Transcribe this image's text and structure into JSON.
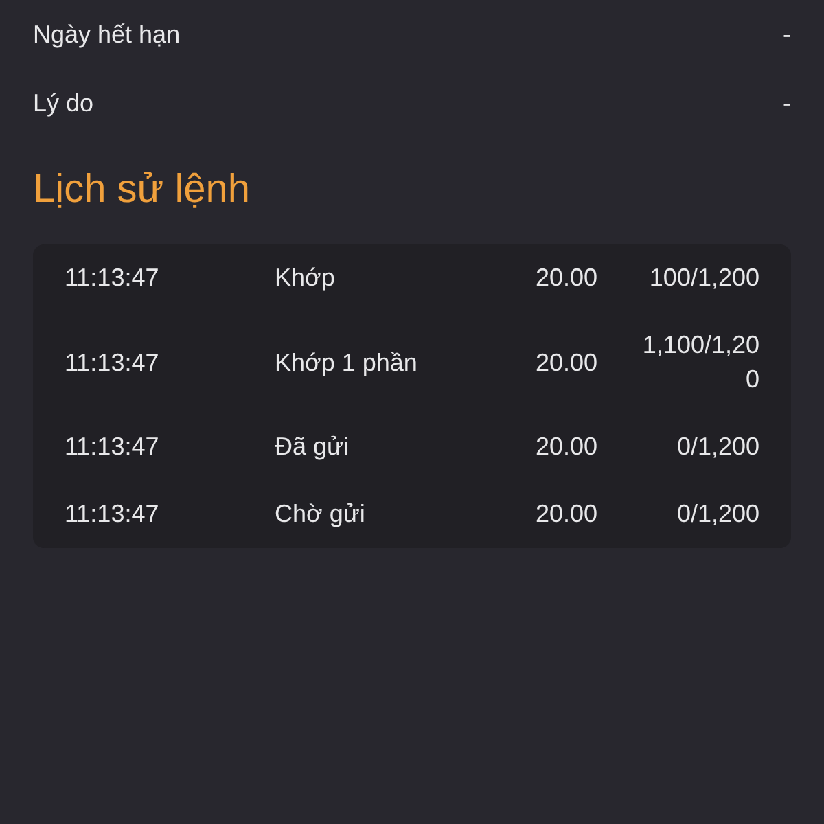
{
  "details": [
    {
      "label": "Ngày hết hạn",
      "value": "-"
    },
    {
      "label": "Lý do",
      "value": "-"
    }
  ],
  "section_title": "Lịch sử lệnh",
  "history": [
    {
      "time": "11:13:47",
      "status": "Khớp",
      "price": "20.00",
      "quantity": "100/1,200"
    },
    {
      "time": "11:13:47",
      "status": "Khớp 1 phần",
      "price": "20.00",
      "quantity": "1,100/1,200"
    },
    {
      "time": "11:13:47",
      "status": "Đã gửi",
      "price": "20.00",
      "quantity": "0/1,200"
    },
    {
      "time": "11:13:47",
      "status": "Chờ gửi",
      "price": "20.00",
      "quantity": "0/1,200"
    }
  ]
}
